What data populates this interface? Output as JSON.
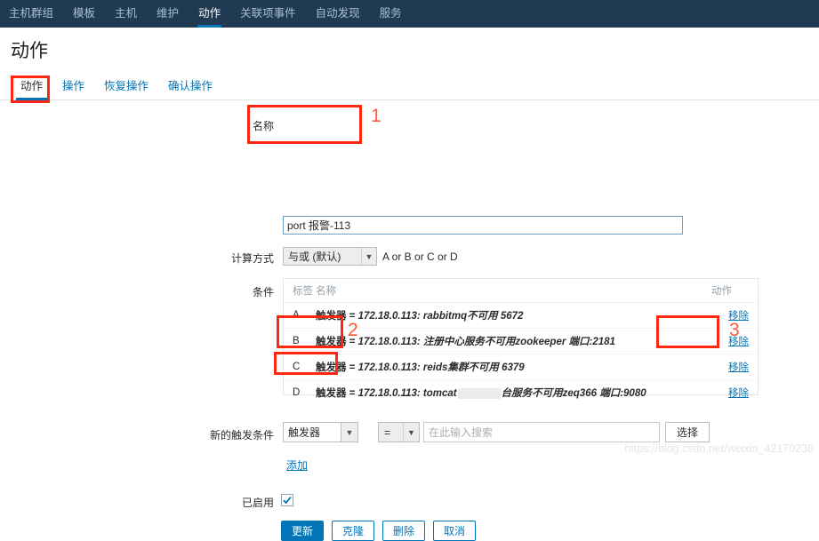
{
  "topnav": {
    "items": [
      {
        "label": "主机群组",
        "active": false
      },
      {
        "label": "模板",
        "active": false
      },
      {
        "label": "主机",
        "active": false
      },
      {
        "label": "维护",
        "active": false
      },
      {
        "label": "动作",
        "active": true
      },
      {
        "label": "关联项事件",
        "active": false
      },
      {
        "label": "自动发现",
        "active": false
      },
      {
        "label": "服务",
        "active": false
      }
    ]
  },
  "page": {
    "title": "动作"
  },
  "tabs": [
    {
      "label": "动作",
      "active": true
    },
    {
      "label": "操作",
      "active": false
    },
    {
      "label": "恢复操作",
      "active": false
    },
    {
      "label": "确认操作",
      "active": false
    }
  ],
  "form": {
    "name": {
      "label": "名称",
      "value": "port 报警-113"
    },
    "calculation": {
      "label": "计算方式",
      "selected": "与或 (默认)",
      "formula": "A or B or C or D"
    },
    "conditions": {
      "label": "条件",
      "headers": {
        "tag": "标签",
        "name": "名称",
        "action": "动作"
      },
      "remove_label": "移除",
      "rows": [
        {
          "tag": "A",
          "type": "触发器",
          "operator": "=",
          "expression": "172.18.0.113: rabbitmq不可用 5672",
          "redacted": false
        },
        {
          "tag": "B",
          "type": "触发器",
          "operator": "=",
          "expression": "172.18.0.113: 注册中心服务不可用zookeeper 端口:2181",
          "redacted": false
        },
        {
          "tag": "C",
          "type": "触发器",
          "operator": "=",
          "expression": "172.18.0.113: reids集群不可用 6379",
          "redacted": false
        },
        {
          "tag": "D",
          "type": "触发器",
          "operator": "=",
          "expression_before": "172.18.0.113: tomcat",
          "expression_after": "台服务不可用zeq366 端口:9080",
          "redacted": true
        }
      ]
    },
    "new_condition": {
      "label": "新的触发条件",
      "type_selected": "触发器",
      "operator_selected": "=",
      "search_placeholder": "在此输入搜索",
      "search_value": "",
      "select_button": "选择",
      "add_link": "添加"
    },
    "enabled": {
      "label": "已启用",
      "checked": true
    },
    "buttons": [
      {
        "label": "更新",
        "style": "primary"
      },
      {
        "label": "克隆",
        "style": "secondary"
      },
      {
        "label": "删除",
        "style": "secondary"
      },
      {
        "label": "取消",
        "style": "secondary"
      }
    ]
  },
  "annotations": [
    {
      "number": "1"
    },
    {
      "number": "2"
    },
    {
      "number": "3"
    }
  ],
  "watermark": "https://blog.csdn.net/weixin_42170236",
  "colors": {
    "nav_bg": "#1f3a52",
    "accent": "#0275b8",
    "annotation": "#fe2712",
    "annotation_number": "#fe5a3c"
  }
}
